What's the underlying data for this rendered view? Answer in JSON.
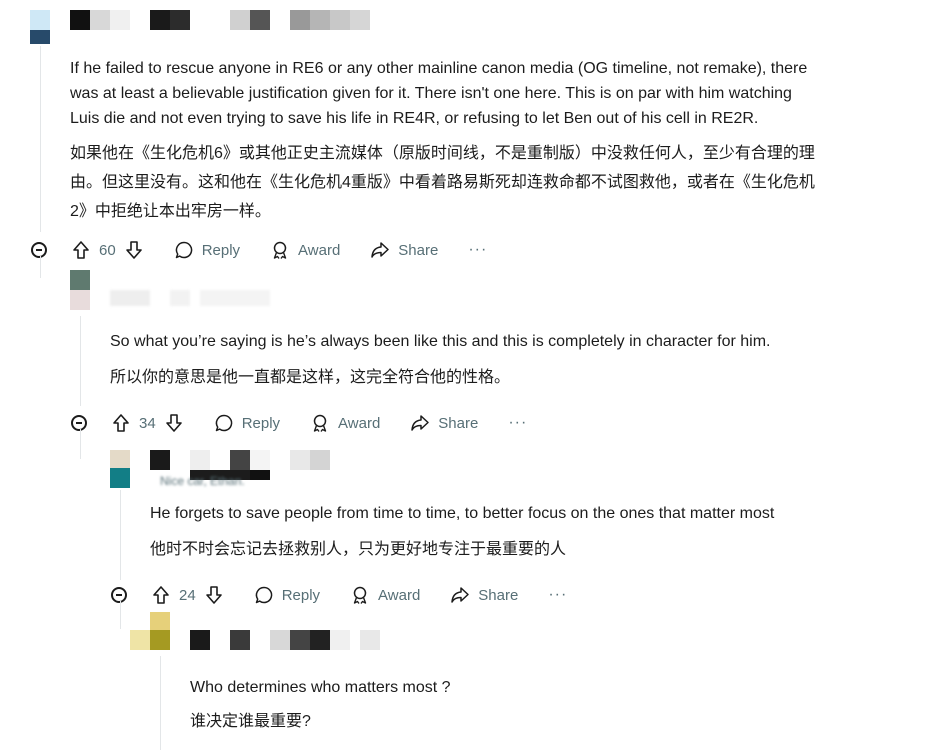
{
  "colors": {
    "text": "#1c1c1c",
    "meta": "#576f76",
    "thread_line": "#e3e6e8"
  },
  "icons": {
    "upvote": "arrow-up-outline-icon",
    "downvote": "arrow-down-outline-icon",
    "reply": "speech-bubble-icon",
    "award": "award-ribbon-icon",
    "share": "share-arrow-icon",
    "more": "more-horizontal-icon",
    "collapse": "collapse-minus-circle-icon"
  },
  "comments": [
    {
      "paragraphs": [
        "If he failed to rescue anyone in RE6 or any other mainline canon media (OG timeline, not remake), there",
        "was at least a believable justification given for it. There isn't one here. This is on par with him watching",
        "Luis die and not even trying to save his life in RE4R, or refusing to let Ben out of his cell in RE2R."
      ],
      "translation": [
        "如果他在《生化危机6》或其他正史主流媒体（原版时间线，不是重制版）中没救任何人，至少有合理的理",
        "由。但这里没有。这和他在《生化危机4重版》中看着路易斯死却连救命都不试图救他，或者在《生化危机",
        "2》中拒绝让本出牢房一样。"
      ],
      "votes": "60",
      "reply": "Reply",
      "award": "Award",
      "share": "Share",
      "more": "···"
    },
    {
      "paragraphs": [
        "So what you’re saying is he’s always been like this and this is completely in character for him."
      ],
      "translation": [
        "所以你的意思是他一直都是这样，这完全符合他的性格。"
      ],
      "votes": "34",
      "reply": "Reply",
      "award": "Award",
      "share": "Share",
      "more": "···"
    },
    {
      "flair": "Nice car, Ethan.",
      "paragraphs": [
        "He forgets to save people from time to time, to better focus on the ones that matter most"
      ],
      "translation": [
        "他时不时会忘记去拯救别人，只为更好地专注于最重要的人"
      ],
      "votes": "24",
      "reply": "Reply",
      "award": "Award",
      "share": "Share",
      "more": "···"
    },
    {
      "paragraphs": [
        "Who determines who matters most ?"
      ],
      "translation": [
        "谁决定谁最重要?"
      ]
    }
  ]
}
